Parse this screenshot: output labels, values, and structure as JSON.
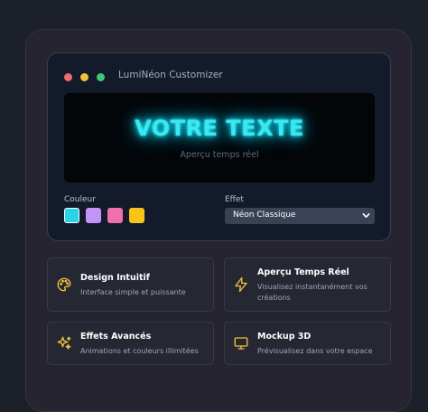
{
  "window": {
    "title": "LumiNéon Customizer"
  },
  "preview": {
    "neon_text": "VOTRE TEXTE",
    "caption": "Aperçu temps réel",
    "neon_color": "#3ae8f2"
  },
  "controls": {
    "color_label": "Couleur",
    "colors": [
      "#2ad3ea",
      "#c393f7",
      "#f06fad",
      "#f8c418"
    ],
    "effect_label": "Effet",
    "effect_value": "Néon Classique"
  },
  "features": [
    {
      "title": "Design Intuitif",
      "desc": "Interface simple et puissante",
      "icon": "palette-icon"
    },
    {
      "title": "Aperçu Temps Réel",
      "desc": "Visualisez instantanément vos créations",
      "icon": "lightning-icon"
    },
    {
      "title": "Effets Avancés",
      "desc": "Animations et couleurs illimitées",
      "icon": "sparkles-icon"
    },
    {
      "title": "Mockup 3D",
      "desc": "Prévisualisez dans votre espace",
      "icon": "monitor-icon"
    }
  ],
  "accent_color": "#f5c13c"
}
